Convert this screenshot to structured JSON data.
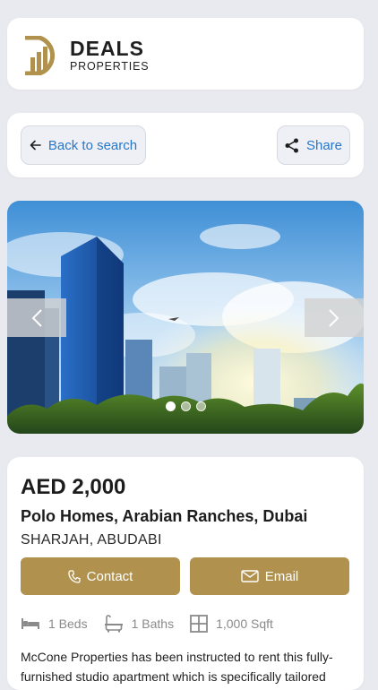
{
  "brand": {
    "name": "DEALS",
    "sub": "PROPERTIES"
  },
  "nav": {
    "back_label": "Back to search",
    "share_label": "Share"
  },
  "gallery": {
    "slide_count": 3,
    "active_index": 0
  },
  "listing": {
    "price": "AED 2,000",
    "title": "Polo Homes, Arabian Ranches, Dubai",
    "location": "SHARJAH, ABUDABI",
    "contact_label": "Contact",
    "email_label": "Email",
    "beds": "1 Beds",
    "baths": "1 Baths",
    "area": "1,000 Sqft",
    "description": "McCone Properties has been instructed to rent this fully-furnished studio apartment which is specifically tailored"
  },
  "colors": {
    "accent_gold": "#b0914e",
    "link_blue": "#2777c9",
    "background": "#e9eaef"
  }
}
